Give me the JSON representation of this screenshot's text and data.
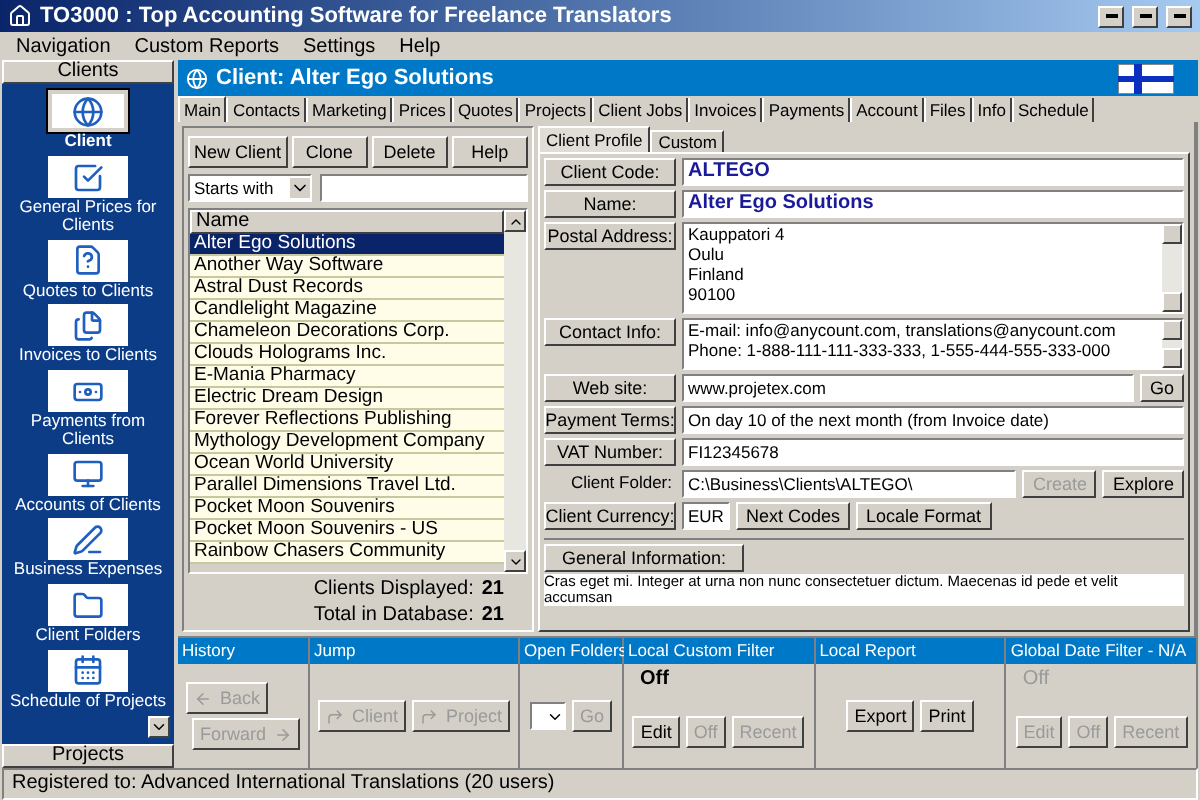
{
  "window": {
    "title": "TO3000 : Top Accounting Software for Freelance Translators"
  },
  "menu": [
    "Navigation",
    "Custom Reports",
    "Settings",
    "Help"
  ],
  "sidebar": {
    "header": "Clients",
    "footer": "Projects",
    "items": [
      {
        "label": "Client",
        "selected": true
      },
      {
        "label": "General Prices for Clients",
        "selected": false
      },
      {
        "label": "Quotes to Clients",
        "selected": false
      },
      {
        "label": "Invoices to Clients",
        "selected": false
      },
      {
        "label": "Payments from Clients",
        "selected": false
      },
      {
        "label": "Accounts of Clients",
        "selected": false
      },
      {
        "label": "Business Expenses",
        "selected": false
      },
      {
        "label": "Client Folders",
        "selected": false
      },
      {
        "label": "Schedule of Projects",
        "selected": false
      }
    ]
  },
  "client_header": {
    "title": "Client: Alter Ego Solutions"
  },
  "tabs": [
    {
      "label": "Main",
      "selected": true
    },
    {
      "label": "Contacts",
      "selected": false
    },
    {
      "label": "Marketing",
      "selected": false
    },
    {
      "label": "Prices",
      "selected": false
    },
    {
      "label": "Quotes",
      "selected": false
    },
    {
      "label": "Projects",
      "selected": false
    },
    {
      "label": "Client Jobs",
      "selected": false
    },
    {
      "label": "Invoices",
      "selected": false
    },
    {
      "label": "Payments",
      "selected": false
    },
    {
      "label": "Account",
      "selected": false
    },
    {
      "label": "Files",
      "selected": false
    },
    {
      "label": "Info",
      "selected": false
    },
    {
      "label": "Schedule",
      "selected": false
    }
  ],
  "list_panel": {
    "buttons": [
      "New Client",
      "Clone",
      "Delete",
      "Help"
    ],
    "filter_mode": "Starts with",
    "column": "Name",
    "rows": [
      {
        "name": "Alter Ego Solutions",
        "selected": true
      },
      {
        "name": "Another Way Software",
        "selected": false
      },
      {
        "name": "Astral Dust Records",
        "selected": false
      },
      {
        "name": "Candlelight Magazine",
        "selected": false
      },
      {
        "name": "Chameleon Decorations Corp.",
        "selected": false
      },
      {
        "name": "Clouds Holograms Inc.",
        "selected": false
      },
      {
        "name": "E-Mania Pharmacy",
        "selected": false
      },
      {
        "name": "Electric Dream Design",
        "selected": false
      },
      {
        "name": "Forever Reflections Publishing",
        "selected": false
      },
      {
        "name": "Mythology Development Company",
        "selected": false
      },
      {
        "name": "Ocean World University",
        "selected": false
      },
      {
        "name": "Parallel Dimensions Travel Ltd.",
        "selected": false
      },
      {
        "name": "Pocket Moon Souvenirs",
        "selected": false
      },
      {
        "name": "Pocket Moon Souvenirs - US",
        "selected": false
      },
      {
        "name": "Rainbow Chasers Community",
        "selected": false
      }
    ],
    "stats": [
      {
        "label": "Clients Displayed:",
        "value": "21"
      },
      {
        "label": "Total in Database:",
        "value": "21"
      }
    ]
  },
  "profile_tabs": [
    {
      "label": "Client Profile",
      "selected": true
    },
    {
      "label": "Custom",
      "selected": false
    }
  ],
  "fields": [
    {
      "kind": "highlight",
      "label": "Client Code:",
      "value": "ALTEGO"
    },
    {
      "kind": "highlight",
      "label": "Name:",
      "value": "Alter Ego Solutions"
    },
    {
      "kind": "multiline",
      "label": "Postal Address:",
      "lines": [
        "Kauppatori 4",
        "Oulu",
        "Finland",
        "90100"
      ]
    },
    {
      "kind": "multiline",
      "label": "Contact Info:",
      "lines": [
        "E-mail: info@anycount.com, translations@anycount.com",
        "Phone: 1-888-111-111-333-333, 1-555-444-555-333-000"
      ]
    },
    {
      "kind": "text",
      "label": "Web site:",
      "value": "www.projetex.com",
      "buttons": [
        {
          "label": "Go",
          "disabled": false
        }
      ]
    },
    {
      "kind": "text",
      "label": "Payment Terms:",
      "value": "On day 10 of the next month (from Invoice date)"
    },
    {
      "kind": "text",
      "label": "VAT Number:",
      "value": "FI12345678"
    },
    {
      "kind": "plain",
      "label": "Client Folder:",
      "value": "C:\\Business\\Clients\\ALTEGO\\",
      "buttons": [
        {
          "label": "Create",
          "disabled": true
        },
        {
          "label": "Explore",
          "disabled": false
        }
      ]
    },
    {
      "kind": "short",
      "label": "Client Currency:",
      "value": "EUR",
      "buttons": [
        {
          "label": "Next Codes",
          "disabled": false
        },
        {
          "label": "Locale Format",
          "disabled": false
        }
      ]
    }
  ],
  "general_info": {
    "button": "General Information:",
    "text": "Cras eget mi. Integer at urna non nunc consectetuer dictum. Maecenas id pede et velit accumsan"
  },
  "bottom_sections": [
    {
      "kind": "stack",
      "title": "History",
      "buttons": [
        {
          "label": "Back",
          "disabled": true
        },
        {
          "label": "Forward",
          "disabled": true
        }
      ]
    },
    {
      "kind": "row",
      "title": "Jump",
      "buttons": [
        {
          "label": "Client",
          "disabled": true
        },
        {
          "label": "Project",
          "disabled": true
        }
      ]
    },
    {
      "kind": "folders",
      "title": "Open Folders",
      "buttons": [
        {
          "label": "Go",
          "disabled": true
        }
      ]
    },
    {
      "kind": "row",
      "title": "Local Custom Filter",
      "status": {
        "text": "Off",
        "disabled": false
      },
      "buttons": [
        {
          "label": "Edit",
          "disabled": false
        },
        {
          "label": "Off",
          "disabled": true
        },
        {
          "label": "Recent",
          "disabled": true
        }
      ]
    },
    {
      "kind": "row",
      "title": "Local Report",
      "buttons": [
        {
          "label": "Export",
          "disabled": false
        },
        {
          "label": "Print",
          "disabled": false
        }
      ]
    },
    {
      "kind": "row",
      "title": "Global Date Filter -  N/A",
      "status": {
        "text": "Off",
        "disabled": true
      },
      "buttons": [
        {
          "label": "Edit",
          "disabled": true
        },
        {
          "label": "Off",
          "disabled": true
        },
        {
          "label": "Recent",
          "disabled": true
        }
      ]
    }
  ],
  "status_bar": "Registered to: Advanced International Translations (20 users)"
}
